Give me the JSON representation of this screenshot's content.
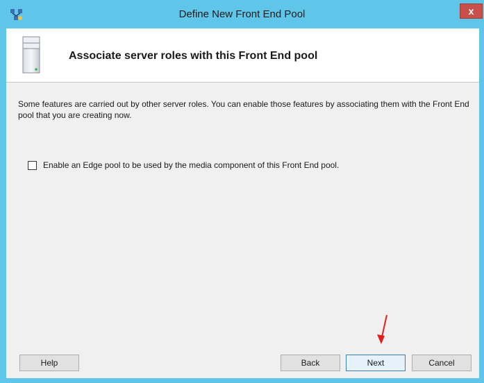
{
  "window": {
    "title": "Define New Front End Pool",
    "close_glyph": "x",
    "app_icon": "topology-builder-icon"
  },
  "header": {
    "icon": "server-icon",
    "title": "Associate server roles with this Front End pool"
  },
  "main": {
    "description": "Some features are carried out by other server roles. You can enable those features by associating them with the Front End pool that you are creating now.",
    "edge_checkbox": {
      "label": "Enable an Edge pool to be used by the media component of this Front End pool.",
      "checked": false
    }
  },
  "footer": {
    "help_label": "Help",
    "back_label": "Back",
    "next_label": "Next",
    "cancel_label": "Cancel"
  },
  "annotation": {
    "arrow_icon": "red-arrow-icon",
    "color": "#e02020"
  },
  "colors": {
    "titlebar": "#5fc6ea",
    "close_button": "#c7504a",
    "client_background": "#f0f0f0"
  }
}
